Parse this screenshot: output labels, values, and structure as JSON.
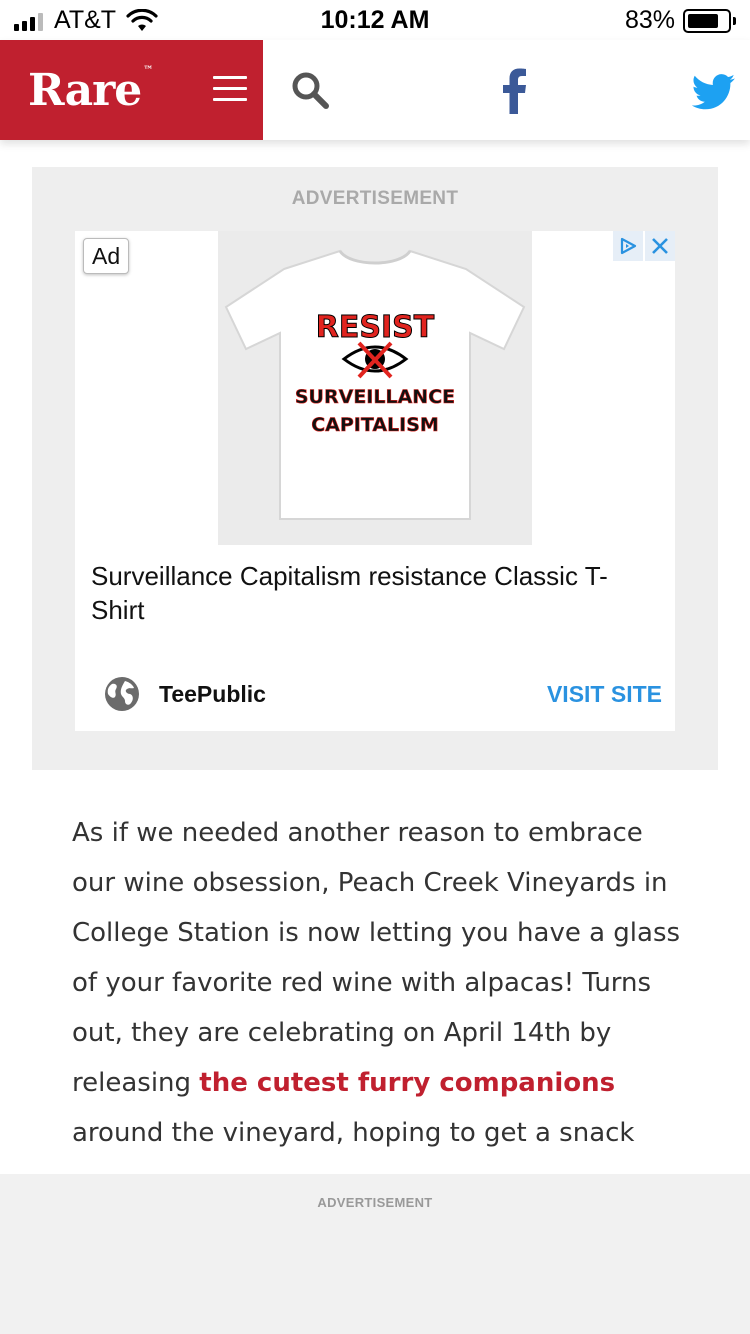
{
  "status_bar": {
    "carrier": "AT&T",
    "time": "10:12 AM",
    "battery_percent": "83%",
    "battery_level": 0.83,
    "icons": [
      "signal-icon",
      "wifi-icon",
      "battery-icon"
    ]
  },
  "header": {
    "logo": "Rare",
    "logo_mark": "™",
    "icons": [
      "menu-icon",
      "search-icon",
      "facebook-icon",
      "twitter-icon"
    ],
    "colors": {
      "brand_red": "#c0202f",
      "facebook_blue": "#3b5998",
      "twitter_blue": "#1da1f2"
    }
  },
  "ad": {
    "label": "ADVERTISEMENT",
    "badge": "Ad",
    "product_image": {
      "line1": "RESIST",
      "line2": "SURVEILLANCE",
      "line3": "CAPITALISM"
    },
    "title": "Surveillance Capitalism resistance Classic T-Shirt",
    "advertiser": "TeePublic",
    "cta": "VISIT SITE",
    "colors": {
      "cta_blue": "#2a92e0"
    }
  },
  "article": {
    "text_before_link": "As if we needed another reason to embrace our wine obsession, Peach Creek Vineyards in College Station is now letting you have a glass of your favorite red wine with alpacas! Turns out, they are celebrating on April 14th by releasing ",
    "link_text": "the cutest furry companions",
    "text_after_link": " around the vineyard, hoping to get a snack"
  },
  "bottom_ad": {
    "label": "ADVERTISEMENT"
  }
}
